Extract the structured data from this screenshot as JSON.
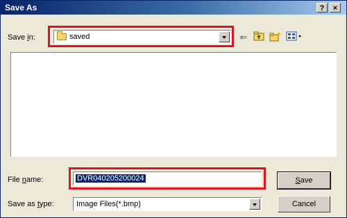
{
  "window": {
    "title": "Save As",
    "help_btn": "?",
    "close_btn": "×"
  },
  "toolbar": {
    "save_in_prefix": "Save ",
    "save_in_access": "i",
    "save_in_suffix": "n:",
    "current_folder": "saved",
    "icons": [
      "back-arrow-icon",
      "up-folder-icon",
      "new-folder-icon",
      "view-menu-icon"
    ]
  },
  "form": {
    "file_name_prefix": "File ",
    "file_name_access": "n",
    "file_name_suffix": "ame:",
    "file_name_value": "DVR040205200024",
    "save_as_prefix": "Save as ",
    "save_as_access": "t",
    "save_as_suffix": "ype:",
    "save_as_value": "Image Files(*.bmp)"
  },
  "buttons": {
    "save_access": "S",
    "save_rest": "ave",
    "cancel_label": "Cancel"
  },
  "highlight_color": "#e0141e"
}
